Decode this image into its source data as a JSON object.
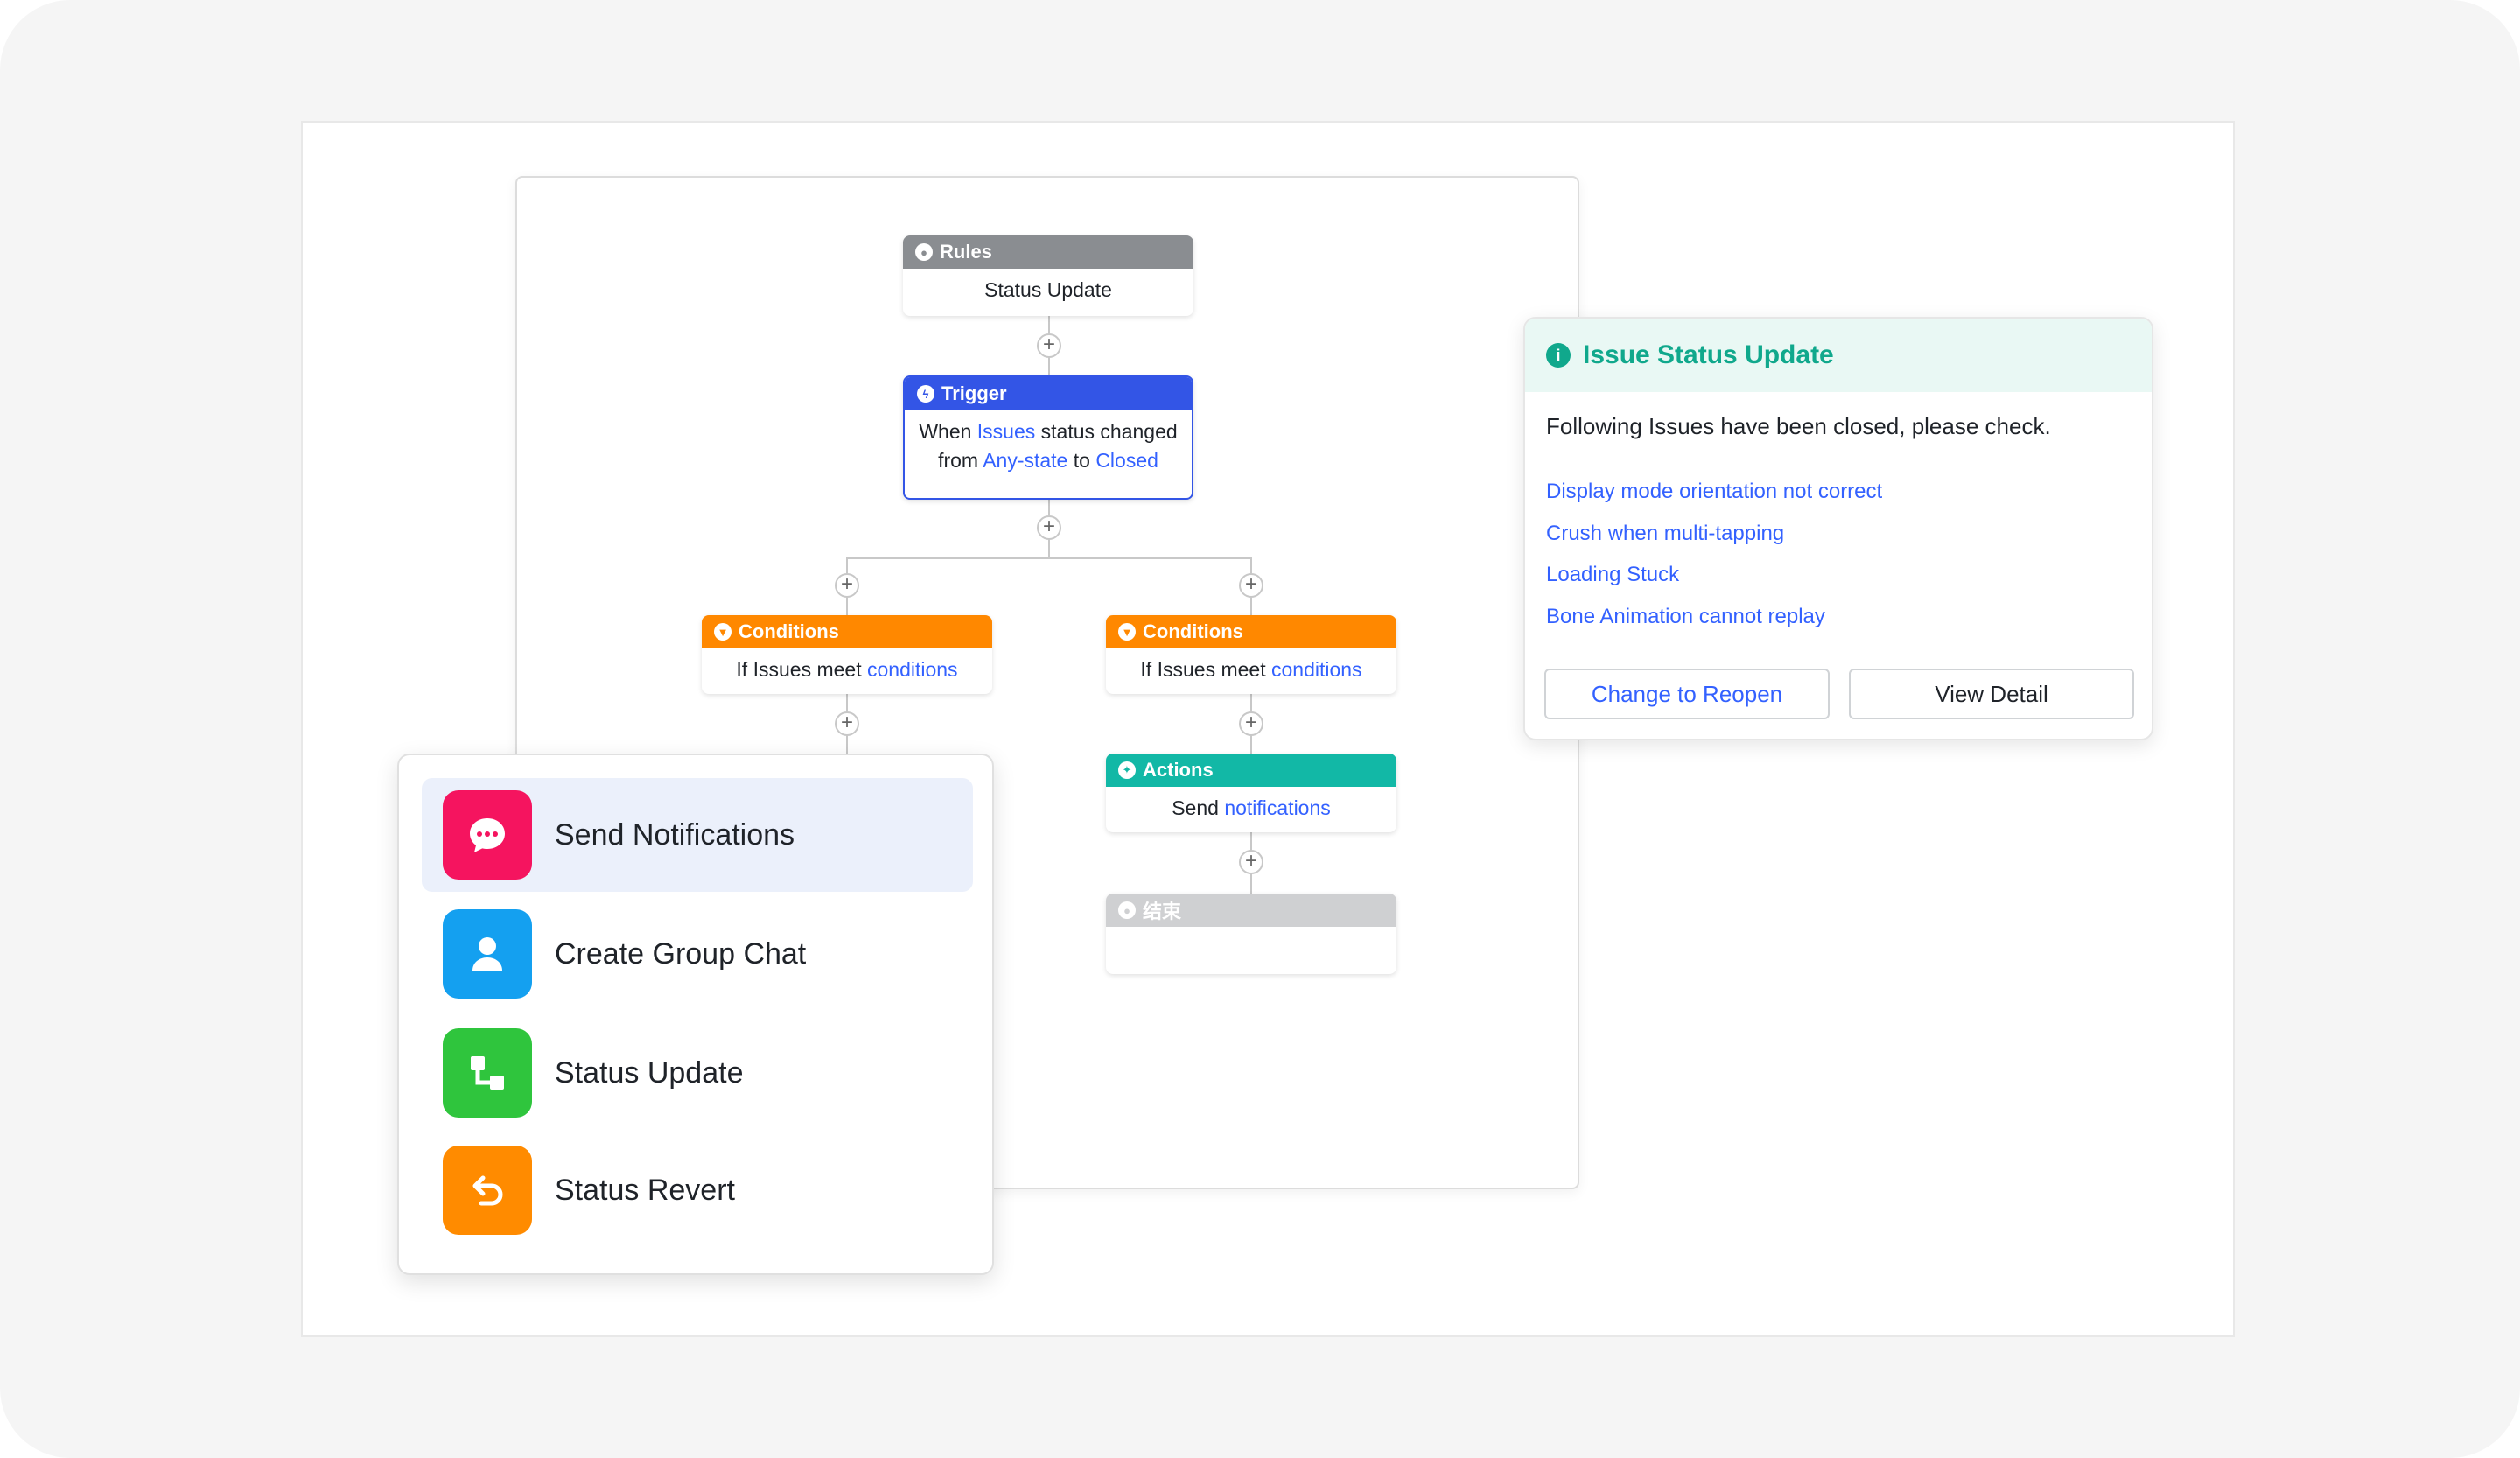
{
  "flow": {
    "rules": {
      "header": "Rules",
      "body": "Status Update"
    },
    "trigger": {
      "header": "Trigger",
      "line1_pre": "When ",
      "line1_link": "Issues",
      "line1_post": " status changed",
      "line2_pre": "from ",
      "line2_link1": "Any-state",
      "line2_mid": " to ",
      "line2_link2": "Closed"
    },
    "conditions_left": {
      "header": "Conditions",
      "body_pre": "If Issues meet ",
      "body_link": "conditions"
    },
    "conditions_right": {
      "header": "Conditions",
      "body_pre": "If Issues meet ",
      "body_link": "conditions"
    },
    "actions": {
      "header": "Actions",
      "body_pre": "Send ",
      "body_link": "notifications"
    },
    "end": {
      "header": "结束"
    },
    "plus_symbol": "+"
  },
  "popup": {
    "title": "Issue Status Update",
    "info_icon": "i",
    "message": "Following Issues have been closed, please check.",
    "issues": [
      "Display mode orientation not correct",
      "Crush when multi-tapping",
      "Loading Stuck",
      "Bone Animation cannot replay"
    ],
    "reopen_button": "Change to Reopen",
    "detail_button": "View Detail"
  },
  "menu": {
    "items": [
      {
        "label": "Send Notifications",
        "icon": "chat-bubble-icon",
        "color": "#f5145f"
      },
      {
        "label": "Create Group Chat",
        "icon": "person-icon",
        "color": "#14a0f0"
      },
      {
        "label": "Status Update",
        "icon": "flow-icon",
        "color": "#2fc53d"
      },
      {
        "label": "Status Revert",
        "icon": "undo-icon",
        "color": "#ff8b00"
      }
    ]
  }
}
